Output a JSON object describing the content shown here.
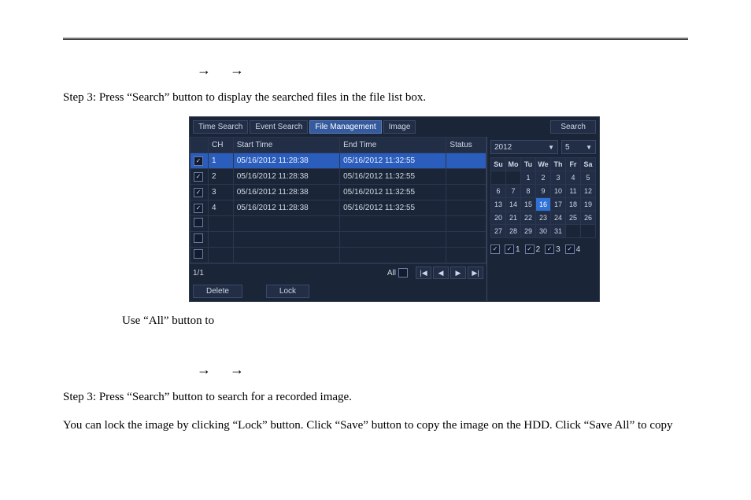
{
  "doc": {
    "arrow1": "→",
    "arrow2": "→",
    "step3a": "Step 3: Press “Search” button to display the searched files in the file list box.",
    "useAll": "Use “All” button to",
    "step3b": "Step 3: Press “Search” button to search for a recorded image.",
    "lockSave": "You can lock the image by clicking “Lock” button. Click “Save” button to copy the image on the HDD. Click “Save All” to copy"
  },
  "ui": {
    "tabs": {
      "time": "Time Search",
      "event": "Event Search",
      "file": "File Management",
      "image": "Image"
    },
    "searchBtn": "Search",
    "headers": {
      "ch": "CH",
      "start": "Start Time",
      "end": "End Time",
      "status": "Status"
    },
    "rows": [
      {
        "ch": "1",
        "start": "05/16/2012 11:28:38",
        "end": "05/16/2012 11:32:55",
        "status": ""
      },
      {
        "ch": "2",
        "start": "05/16/2012 11:28:38",
        "end": "05/16/2012 11:32:55",
        "status": ""
      },
      {
        "ch": "3",
        "start": "05/16/2012 11:28:38",
        "end": "05/16/2012 11:32:55",
        "status": ""
      },
      {
        "ch": "4",
        "start": "05/16/2012 11:28:38",
        "end": "05/16/2012 11:32:55",
        "status": ""
      }
    ],
    "pager": {
      "page": "1/1",
      "all": "All",
      "first": "|◀",
      "prev": "◀",
      "next": "▶",
      "last": "▶|"
    },
    "bottom": {
      "delete": "Delete",
      "lock": "Lock"
    },
    "year": "2012",
    "month": "5",
    "weekdays": [
      "Su",
      "Mo",
      "Tu",
      "We",
      "Th",
      "Fr",
      "Sa"
    ],
    "calendar": [
      [
        "",
        "",
        "1",
        "2",
        "3",
        "4",
        "5"
      ],
      [
        "6",
        "7",
        "8",
        "9",
        "10",
        "11",
        "12"
      ],
      [
        "13",
        "14",
        "15",
        "16",
        "17",
        "18",
        "19"
      ],
      [
        "20",
        "21",
        "22",
        "23",
        "24",
        "25",
        "26"
      ],
      [
        "27",
        "28",
        "29",
        "30",
        "31",
        "",
        ""
      ]
    ],
    "highlightDay": "16",
    "channels": [
      "1",
      "2",
      "3",
      "4"
    ]
  }
}
